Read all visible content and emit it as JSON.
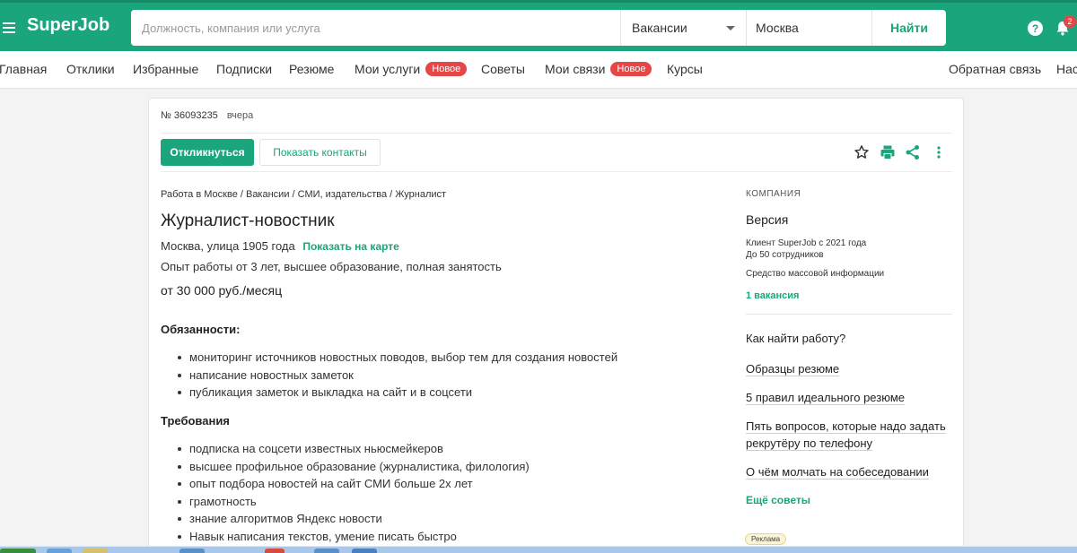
{
  "header": {
    "logo": "SuperJob",
    "search_placeholder": "Должность, компания или услуга",
    "search_type": "Вакансии",
    "city": "Москва",
    "search_button": "Найти",
    "help_symbol": "?",
    "notifications_count": "2",
    "brand_color": "#1aa57c"
  },
  "nav": {
    "items": [
      {
        "label": "Главная"
      },
      {
        "label": "Отклики"
      },
      {
        "label": "Избранные"
      },
      {
        "label": "Подписки"
      },
      {
        "label": "Резюме"
      },
      {
        "label": "Мои услуги",
        "badge": "Новое"
      },
      {
        "label": "Советы"
      },
      {
        "label": "Мои связи",
        "badge": "Новое"
      },
      {
        "label": "Курсы"
      }
    ],
    "right_items": [
      {
        "label": "Обратная связь"
      },
      {
        "label": "Наст"
      }
    ]
  },
  "vacancy": {
    "number": "№ 36093235",
    "date": "вчера",
    "apply_button": "Откликнуться",
    "contacts_button": "Показать контакты",
    "actions": [
      "star-icon",
      "print-icon",
      "share-icon",
      "more-icon"
    ],
    "breadcrumbs": "Работа в Москве / Вакансии / СМИ, издательства / Журналист",
    "title": "Журналист-новостник",
    "address": "Москва, улица 1905 года",
    "map_link": "Показать на карте",
    "requirements_summary": "Опыт работы от 3 лет, высшее образование, полная занятость",
    "salary": "от 30 000 руб./месяц",
    "duties_title": "Обязанности:",
    "duties": [
      "мониторинг источников новостных поводов, выбор тем для создания новостей",
      "написание новостных заметок",
      "публикация заметок и выкладка на сайт и в соцсети"
    ],
    "requirements_title": "Требования",
    "requirements": [
      "подписка на соцсети известных ньюсмейкеров",
      "высшее профильное образование (журналистика, филология)",
      "опыт подбора новостей на сайт СМИ больше 2х лет",
      "грамотность",
      "знание алгоритмов Яндекс новости",
      "Навык написания текстов, умение писать быстро"
    ]
  },
  "company": {
    "label": "КОМПАНИЯ",
    "name": "Версия",
    "client_since": "Клиент SuperJob с 2021 года",
    "size": "До 50 сотрудников",
    "industry": "Средство массовой информации",
    "vacancies_link": "1 вакансия"
  },
  "tips": {
    "heading": "Как найти работу?",
    "links": [
      "Образцы резюме",
      "5 правил идеального резюме",
      "Пять вопросов, которые надо задать рекрутёру по телефону",
      "О чём молчать на собеседовании"
    ],
    "more": "Ещё советы",
    "ad_label": "Реклама"
  }
}
